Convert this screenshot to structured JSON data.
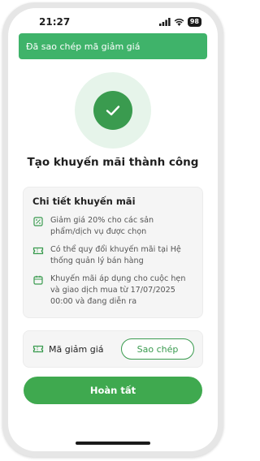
{
  "status_bar": {
    "time": "21:27",
    "battery": "98"
  },
  "toast": {
    "message": "Đã sao chép mã giảm giá"
  },
  "success": {
    "title": "Tạo khuyến mãi thành công"
  },
  "details": {
    "title": "Chi tiết khuyến mãi",
    "items": [
      {
        "icon": "percent-icon",
        "text": "Giảm giá 20% cho các sản phẩm/dịch vụ được chọn"
      },
      {
        "icon": "ticket-icon",
        "text": "Có thể quy đổi khuyến mãi tại Hệ thống quản lý bán hàng"
      },
      {
        "icon": "calendar-icon",
        "text": "Khuyến mãi áp dụng cho cuộc hẹn và giao dịch mua từ 17/07/2025 00:00 và đang diễn ra"
      }
    ]
  },
  "code": {
    "label": "Mã giảm giá",
    "copy_label": "Sao chép",
    "icon": "ticket-icon"
  },
  "finish": {
    "label": "Hoàn tất"
  },
  "colors": {
    "primary": "#3a9b4f",
    "toast": "#3fb36a",
    "success_bg": "#e6f4ea"
  }
}
